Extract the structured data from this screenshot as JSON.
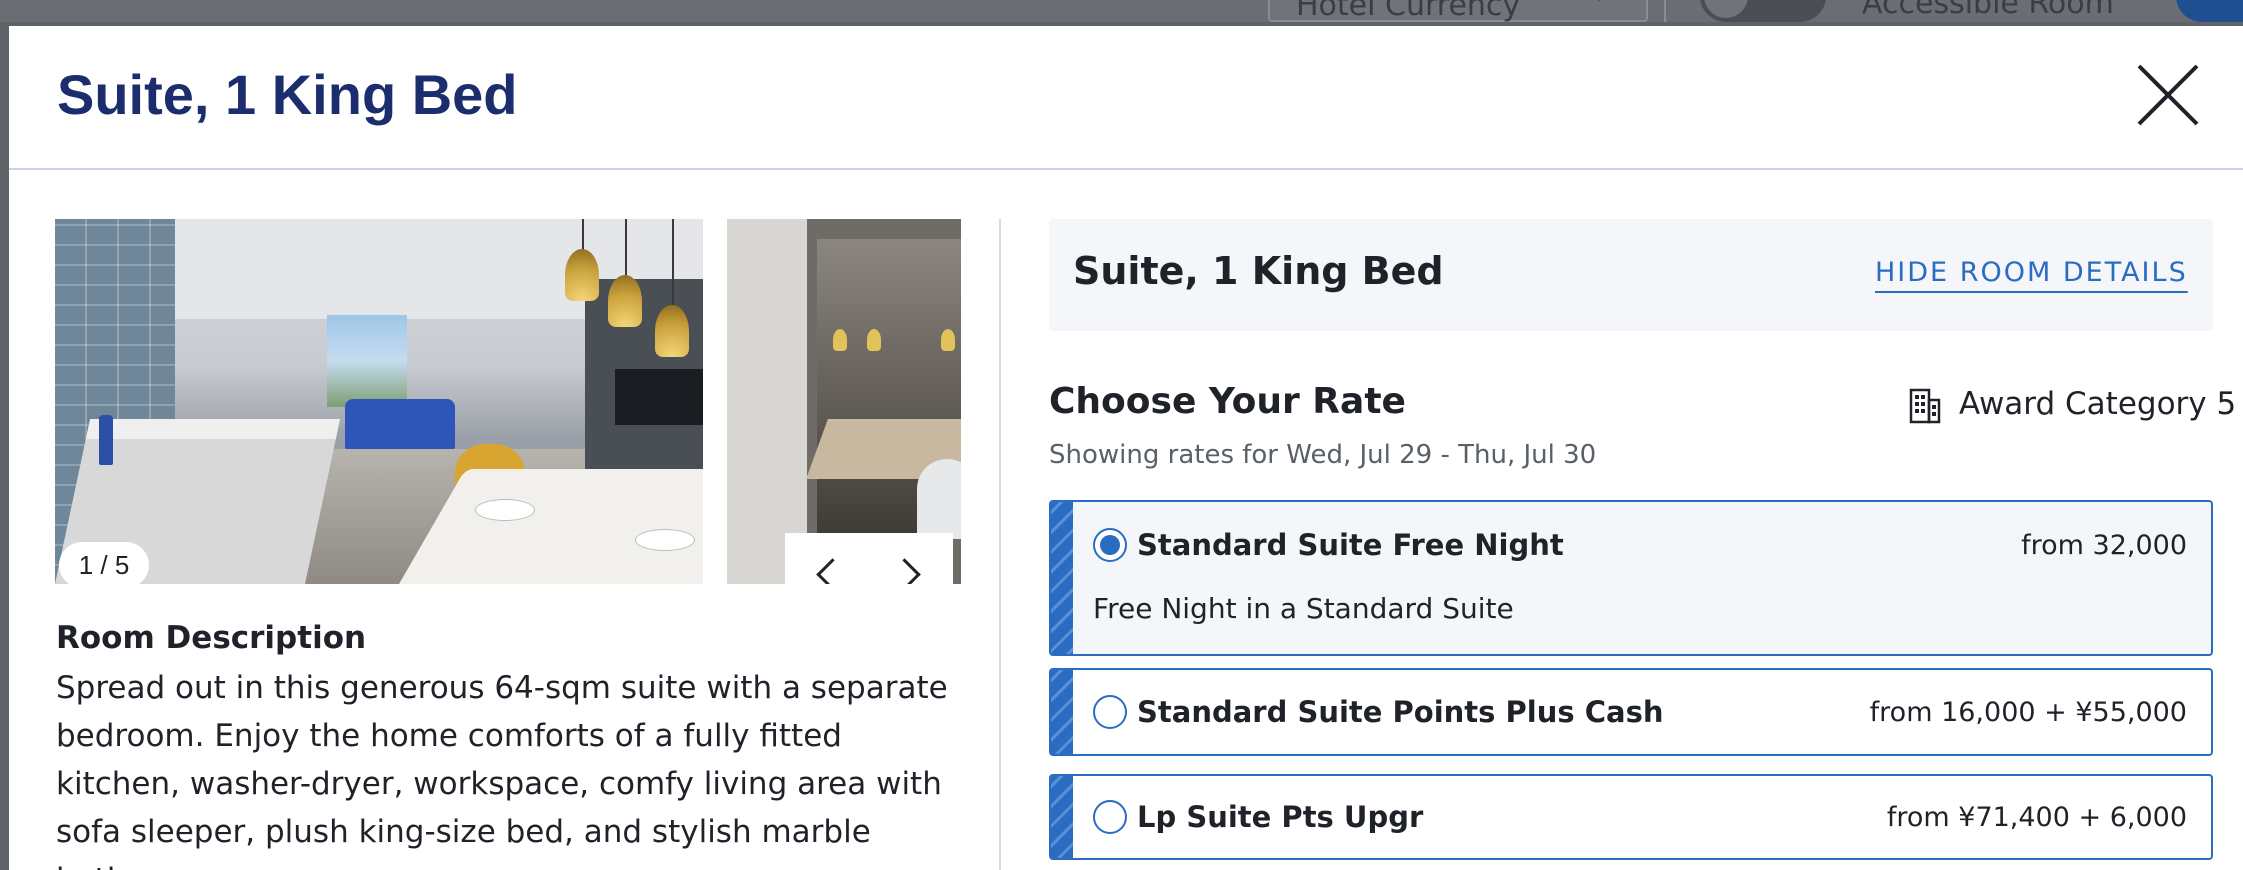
{
  "background": {
    "currency_select_label": "Hotel Currency",
    "accessible_room_label": "Accessible Room",
    "accessible_icon": "wheelchair-icon"
  },
  "modal": {
    "title": "Suite, 1 King Bed",
    "close_icon": "close-icon"
  },
  "gallery": {
    "counter": "1 / 5",
    "prev_icon": "chevron-left-icon",
    "next_icon": "chevron-right-icon"
  },
  "room_description": {
    "heading": "Room Description",
    "text": "Spread out in this generous 64-sqm suite with a separate bedroom. Enjoy the home comforts of a fully fitted kitchen, washer-dryer, workspace, comfy living area with sofa sleeper, plush king-size bed, and stylish marble bathroom."
  },
  "room_summary": {
    "title": "Suite, 1 King Bed",
    "hide_details_label": "HIDE ROOM DETAILS"
  },
  "rates": {
    "heading": "Choose Your Rate",
    "subtitle": "Showing rates for Wed, Jul 29 - Thu, Jul 30",
    "award_icon": "building-icon",
    "award_label": "Award Category 5",
    "options": [
      {
        "name": "Standard Suite Free Night",
        "price": "from 32,000",
        "description": "Free Night in a Standard Suite",
        "selected": true
      },
      {
        "name": "Standard Suite Points Plus Cash",
        "price": "from 16,000 + ¥55,000",
        "selected": false
      },
      {
        "name": "Lp Suite Pts Upgr",
        "price": "from ¥71,400 + 6,000",
        "selected": false
      }
    ]
  },
  "colors": {
    "brand_navy": "#1c2d6e",
    "accent_blue": "#2a6cc2",
    "panel_gray": "#f4f6f9"
  }
}
